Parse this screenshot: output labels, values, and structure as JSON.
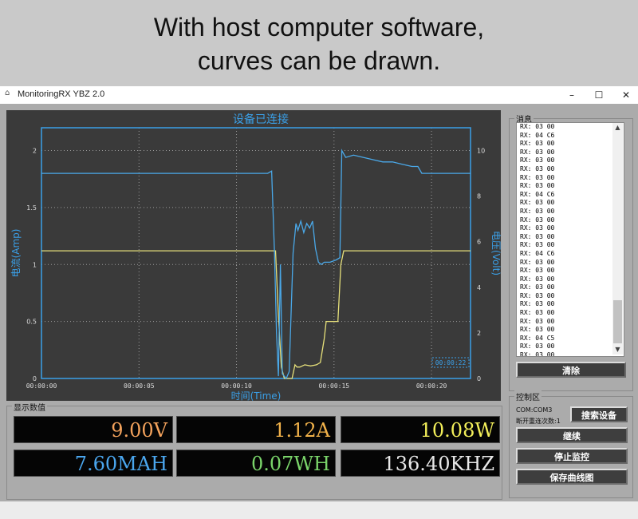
{
  "banner": {
    "line1": "With host computer software,",
    "line2": "curves can be drawn."
  },
  "window": {
    "title": "MonitoringRX YBZ 2.0",
    "minimize": "–",
    "maximize": "☐",
    "close": "✕"
  },
  "colors": {
    "chart_bg": "#3a3a3a",
    "axis_blue": "#3aa0e8",
    "current_yellow": "#e6e07a",
    "voltage_blue": "#4aa8e8"
  },
  "chart_data": {
    "type": "line",
    "title": "设备已连接",
    "xlabel": "时间(Time)",
    "ylabel": "电流(Amp)",
    "y2label": "电压(Volt)",
    "x_ticks": [
      "00:00:00",
      "00:00:05",
      "00:00:10",
      "00:00:15",
      "00:00:20"
    ],
    "xlim": [
      0,
      22
    ],
    "ylim": [
      0,
      2.2
    ],
    "y_ticks": [
      "0",
      "0.5",
      "1",
      "1.5",
      "2"
    ],
    "y2lim": [
      0,
      11
    ],
    "y2_ticks": [
      "0",
      "2",
      "4",
      "6",
      "8",
      "10"
    ],
    "cursor_time": "00:00:22",
    "grid": true,
    "series": [
      {
        "name": "电流(Amp)",
        "axis": "left",
        "color": "#e6e07a",
        "x": [
          0,
          12.0,
          12.15,
          12.3,
          12.45,
          12.55,
          12.7,
          12.85,
          13.0,
          13.1,
          13.25,
          13.5,
          13.8,
          14.1,
          14.3,
          14.5,
          14.6,
          15.2,
          15.35,
          15.5,
          22
        ],
        "y": [
          1.12,
          1.12,
          0.55,
          0.1,
          0.0,
          0.0,
          0.0,
          0.0,
          0.12,
          0.1,
          0.1,
          0.12,
          0.11,
          0.12,
          0.14,
          0.35,
          0.5,
          0.5,
          1.0,
          1.12,
          1.12
        ]
      },
      {
        "name": "电压(Volt)",
        "axis": "right",
        "color": "#4aa8e8",
        "x": [
          0,
          11.6,
          11.8,
          11.95,
          12.05,
          12.15,
          12.25,
          12.35,
          12.45,
          12.55,
          12.7,
          12.9,
          13.05,
          13.15,
          13.3,
          13.45,
          13.6,
          13.75,
          13.9,
          14.05,
          14.2,
          14.35,
          14.5,
          14.8,
          15.1,
          15.3,
          15.4,
          15.6,
          16.0,
          16.5,
          17.0,
          17.5,
          18.0,
          18.5,
          19.0,
          19.3,
          19.5,
          20.0,
          22
        ],
        "y": [
          9.0,
          9.0,
          9.1,
          5.5,
          2.0,
          0.1,
          5.0,
          0.2,
          0.1,
          0.0,
          0.3,
          5.5,
          6.8,
          6.5,
          6.9,
          6.4,
          6.8,
          6.6,
          6.9,
          5.7,
          5.1,
          5.0,
          5.1,
          5.1,
          5.2,
          5.3,
          10.0,
          9.7,
          9.8,
          9.7,
          9.6,
          9.5,
          9.5,
          9.4,
          9.3,
          9.3,
          9.0,
          9.0,
          9.0
        ]
      }
    ]
  },
  "readings": {
    "label": "显示数值",
    "items": [
      {
        "value": "9.00V",
        "color": "#f3a25c"
      },
      {
        "value": "1.12A",
        "color": "#f2b24a"
      },
      {
        "value": "10.08W",
        "color": "#f3ef5a"
      },
      {
        "value": "7.60MAH",
        "color": "#4aa6ee"
      },
      {
        "value": "0.07WH",
        "color": "#7ad46a"
      },
      {
        "value": "136.40KHZ",
        "color": "#e8e8e8"
      }
    ]
  },
  "messages": {
    "label": "消息",
    "rows": [
      "RX: 03 00",
      "RX: 04 C6",
      "RX: 03 00",
      "RX: 03 00",
      "RX: 03 00",
      "RX: 03 00",
      "RX: 03 00",
      "RX: 03 00",
      "RX: 04 C6",
      "RX: 03 00",
      "RX: 03 00",
      "RX: 03 00",
      "RX: 03 00",
      "RX: 03 00",
      "RX: 03 00",
      "RX: 04 C6",
      "RX: 03 00",
      "RX: 03 00",
      "RX: 03 00",
      "RX: 03 00",
      "RX: 03 00",
      "RX: 03 00",
      "RX: 03 00",
      "RX: 03 00",
      "RX: 03 00",
      "RX: 04 C5",
      "RX: 03 00",
      "RX: 03 00",
      "RX: 03 00",
      "RX: 03 00"
    ],
    "clear_button": "清除"
  },
  "control": {
    "label": "控制区",
    "com_port": "COM:COM3",
    "reconnect_count": "断开重连次数:1",
    "search_button": "搜索设备",
    "continue_button": "继续",
    "stop_button": "停止监控",
    "save_button": "保存曲线图"
  }
}
